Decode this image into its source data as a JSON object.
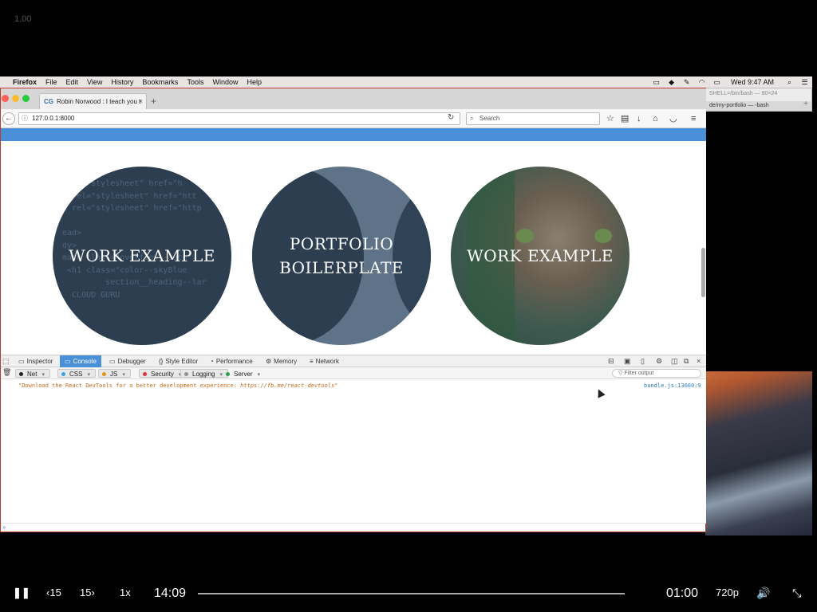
{
  "overlay_label": "1.00",
  "menubar": {
    "app": "Firefox",
    "items": [
      "File",
      "Edit",
      "View",
      "History",
      "Bookmarks",
      "Tools",
      "Window",
      "Help"
    ],
    "clock": "Wed 9:47 AM"
  },
  "terminal": {
    "title": "SHELL=/bin/bash — 80×24",
    "tab_label": "de/my-portfolio — -bash"
  },
  "browser": {
    "tab_title": "Robin Norwood : I teach you t",
    "favicon_text": "CG",
    "url": "127.0.0.1:8000",
    "search_placeholder": "Search"
  },
  "page": {
    "circles": [
      {
        "title": "WORK EXAMPLE"
      },
      {
        "title_line1": "PORTFOLIO",
        "title_line2": "BOILERPLATE"
      },
      {
        "title": "WORK EXAMPLE"
      }
    ],
    "code_snippet": "    =\"stylesheet\" href=\"h\n  rel=\"stylesheet\" href=\"htt\nk rel=\"stylesheet\" href=\"http\n\nead>\ndy>\nmain class=\"overflow--auto\">\n <h1 class=\"color--skyBlue\n         section__heading--lar\n  CLOUD GURU"
  },
  "devtools": {
    "tabs": [
      "Inspector",
      "Console",
      "Debugger",
      "Style Editor",
      "Performance",
      "Memory",
      "Network"
    ],
    "active_tab": "Console",
    "filters": [
      {
        "label": "Net",
        "color": "#222222"
      },
      {
        "label": "CSS",
        "color": "#3aa0e0"
      },
      {
        "label": "JS",
        "color": "#e8901c"
      },
      {
        "label": "Security",
        "color": "#e0303a"
      },
      {
        "label": "Logging",
        "color": "#909090"
      },
      {
        "label": "Server",
        "color": "#2ea04a"
      }
    ],
    "filter_placeholder": "Filter output",
    "message_text": "\"Download the React DevTools for a better development experience: ",
    "message_link": "https://fb.me/react-devtools",
    "message_end": "\"",
    "message_source": "bundle.js:13660:9"
  },
  "player": {
    "rewind_label": "15",
    "forward_label": "15",
    "speed": "1x",
    "elapsed": "14:09",
    "remaining": "01:00",
    "quality": "720p"
  }
}
